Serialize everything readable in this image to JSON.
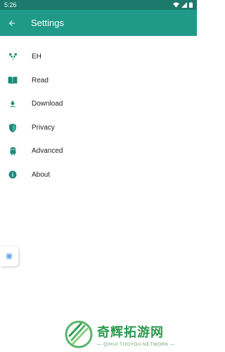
{
  "status_bar": {
    "time": "5:26"
  },
  "app_bar": {
    "title": "Settings"
  },
  "menu": [
    {
      "label": "EH",
      "icon": "panda-icon"
    },
    {
      "label": "Read",
      "icon": "book-icon"
    },
    {
      "label": "Download",
      "icon": "download-icon"
    },
    {
      "label": "Privacy",
      "icon": "shield-icon"
    },
    {
      "label": "Advanced",
      "icon": "android-icon"
    },
    {
      "label": "About",
      "icon": "info-icon"
    }
  ],
  "watermark": {
    "chinese": "奇辉拓游网",
    "english": "— QIHUI TUOYOU NETWORK —"
  },
  "colors": {
    "status_bar": "#1b7a6c",
    "app_bar": "#1f9a88",
    "icon": "#1f8a7a"
  }
}
